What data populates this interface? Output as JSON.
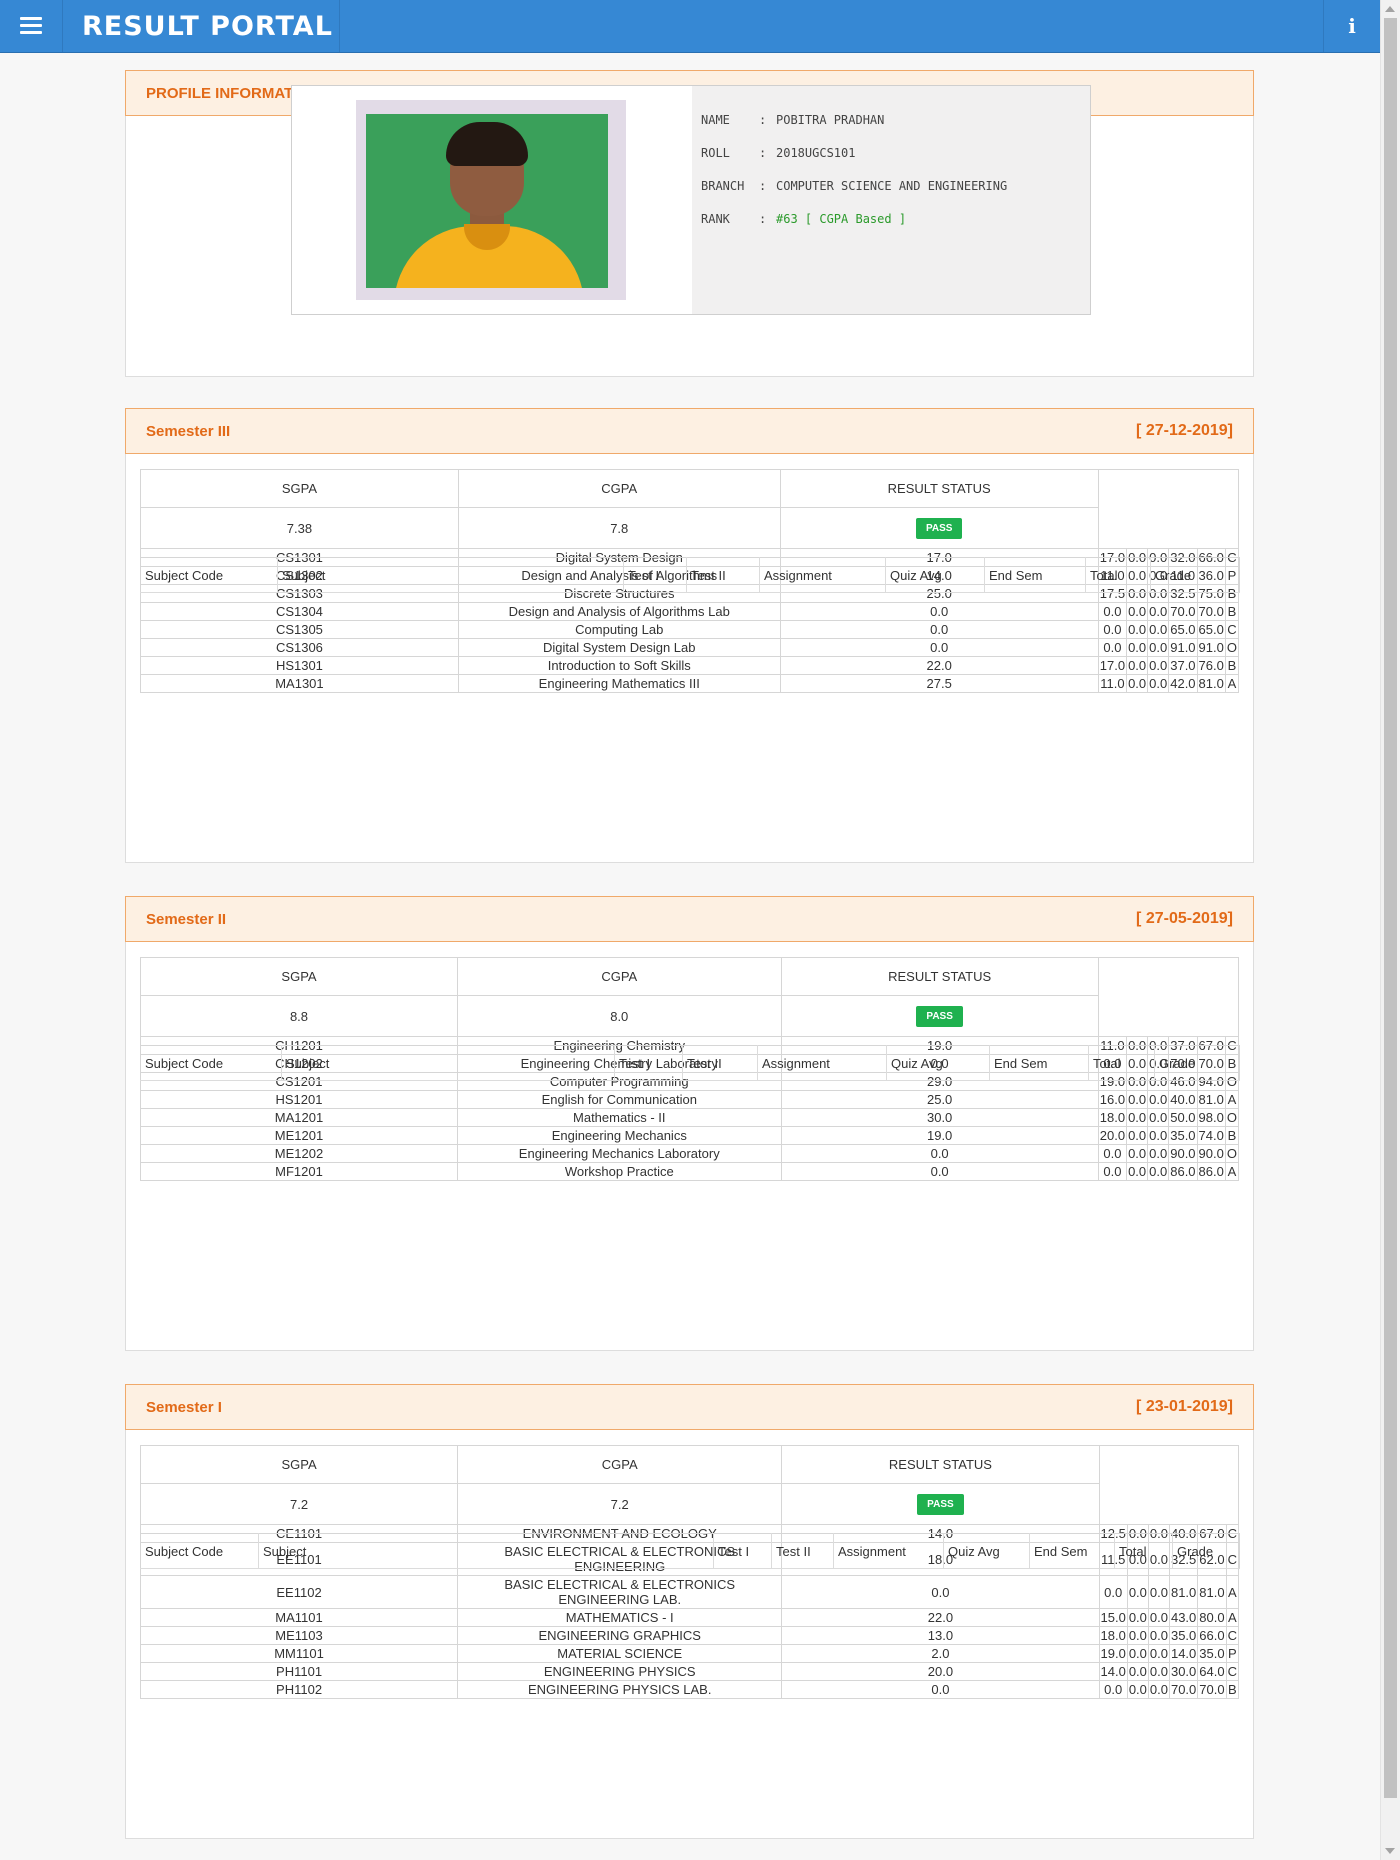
{
  "app": {
    "title": "RESULT PORTAL",
    "menu_icon": "hamburger-menu-icon",
    "info_icon": "info-icon",
    "info_glyph": "i"
  },
  "profile": {
    "header": "PROFILE INFORMATION",
    "name_label": "NAME",
    "name": "POBITRA PRADHAN",
    "roll_label": "ROLL",
    "roll": "2018UGCS101",
    "branch_label": "BRANCH",
    "branch": "COMPUTER SCIENCE AND ENGINEERING",
    "rank_label": "RANK",
    "rank": "#63 [ CGPA Based ]",
    "separator": ":"
  },
  "summary_headers": {
    "sgpa": "SGPA",
    "cgpa": "CGPA",
    "status": "RESULT STATUS"
  },
  "table_headers": [
    "Subject Code",
    "Subject",
    "Test I",
    "Test II",
    "Assignment",
    "Quiz Avg",
    "End Sem",
    "Total",
    "Grade"
  ],
  "colors": {
    "topbar": "#3688d4",
    "panel_header_bg": "#fdf0e2",
    "panel_header_text": "#e26a18",
    "pass_badge": "#1fb14f",
    "rank_text": "#2b9a2b"
  },
  "semesters": [
    {
      "title": "Semester III",
      "date": "[ 27-12-2019]",
      "sgpa": "7.38",
      "cgpa": "7.8",
      "status": "PASS",
      "rows": [
        [
          "CS1301",
          "Digital System Design",
          "17.0",
          "17.0",
          "0.0",
          "0.0",
          "32.0",
          "66.0",
          "C"
        ],
        [
          "CS1302",
          "Design and Analysis of Algorithms",
          "14.0",
          "11.0",
          "0.0",
          "0.0",
          "11.0",
          "36.0",
          "P"
        ],
        [
          "CS1303",
          "Discrete Structures",
          "25.0",
          "17.5",
          "0.0",
          "0.0",
          "32.5",
          "75.0",
          "B"
        ],
        [
          "CS1304",
          "Design and Analysis of Algorithms Lab",
          "0.0",
          "0.0",
          "0.0",
          "0.0",
          "70.0",
          "70.0",
          "B"
        ],
        [
          "CS1305",
          "Computing Lab",
          "0.0",
          "0.0",
          "0.0",
          "0.0",
          "65.0",
          "65.0",
          "C"
        ],
        [
          "CS1306",
          "Digital System Design Lab",
          "0.0",
          "0.0",
          "0.0",
          "0.0",
          "91.0",
          "91.0",
          "O"
        ],
        [
          "HS1301",
          "Introduction to Soft Skills",
          "22.0",
          "17.0",
          "0.0",
          "0.0",
          "37.0",
          "76.0",
          "B"
        ],
        [
          "MA1301",
          "Engineering Mathematics III",
          "27.5",
          "11.0",
          "0.0",
          "0.0",
          "42.0",
          "81.0",
          "A"
        ]
      ]
    },
    {
      "title": "Semester II",
      "date": "[ 27-05-2019]",
      "sgpa": "8.8",
      "cgpa": "8.0",
      "status": "PASS",
      "rows": [
        [
          "CH1201",
          "Engineering Chemistry",
          "19.0",
          "11.0",
          "0.0",
          "0.0",
          "37.0",
          "67.0",
          "C"
        ],
        [
          "CH1202",
          "Engineering Chemistry Laboratory",
          "0.0",
          "0.0",
          "0.0",
          "0.0",
          "70.0",
          "70.0",
          "B"
        ],
        [
          "CS1201",
          "Computer Programming",
          "29.0",
          "19.0",
          "0.0",
          "0.0",
          "46.0",
          "94.0",
          "O"
        ],
        [
          "HS1201",
          "English for Communication",
          "25.0",
          "16.0",
          "0.0",
          "0.0",
          "40.0",
          "81.0",
          "A"
        ],
        [
          "MA1201",
          "Mathematics - II",
          "30.0",
          "18.0",
          "0.0",
          "0.0",
          "50.0",
          "98.0",
          "O"
        ],
        [
          "ME1201",
          "Engineering Mechanics",
          "19.0",
          "20.0",
          "0.0",
          "0.0",
          "35.0",
          "74.0",
          "B"
        ],
        [
          "ME1202",
          "Engineering Mechanics Laboratory",
          "0.0",
          "0.0",
          "0.0",
          "0.0",
          "90.0",
          "90.0",
          "O"
        ],
        [
          "MF1201",
          "Workshop Practice",
          "0.0",
          "0.0",
          "0.0",
          "0.0",
          "86.0",
          "86.0",
          "A"
        ]
      ]
    },
    {
      "title": "Semester I",
      "date": "[ 23-01-2019]",
      "sgpa": "7.2",
      "cgpa": "7.2",
      "status": "PASS",
      "rows": [
        [
          "CE1101",
          "ENVIRONMENT AND ECOLOGY",
          "14.0",
          "12.5",
          "0.0",
          "0.0",
          "40.0",
          "67.0",
          "C"
        ],
        [
          "EE1101",
          "BASIC ELECTRICAL & ELECTRONICS ENGINEERING",
          "18.0",
          "11.5",
          "0.0",
          "0.0",
          "32.5",
          "62.0",
          "C"
        ],
        [
          "EE1102",
          "BASIC ELECTRICAL & ELECTRONICS ENGINEERING LAB.",
          "0.0",
          "0.0",
          "0.0",
          "0.0",
          "81.0",
          "81.0",
          "A"
        ],
        [
          "MA1101",
          "MATHEMATICS - I",
          "22.0",
          "15.0",
          "0.0",
          "0.0",
          "43.0",
          "80.0",
          "A"
        ],
        [
          "ME1103",
          "ENGINEERING GRAPHICS",
          "13.0",
          "18.0",
          "0.0",
          "0.0",
          "35.0",
          "66.0",
          "C"
        ],
        [
          "MM1101",
          "MATERIAL SCIENCE",
          "2.0",
          "19.0",
          "0.0",
          "0.0",
          "14.0",
          "35.0",
          "P"
        ],
        [
          "PH1101",
          "ENGINEERING PHYSICS",
          "20.0",
          "14.0",
          "0.0",
          "0.0",
          "30.0",
          "64.0",
          "C"
        ],
        [
          "PH1102",
          "ENGINEERING PHYSICS LAB.",
          "0.0",
          "0.0",
          "0.0",
          "0.0",
          "70.0",
          "70.0",
          "B"
        ]
      ]
    }
  ]
}
